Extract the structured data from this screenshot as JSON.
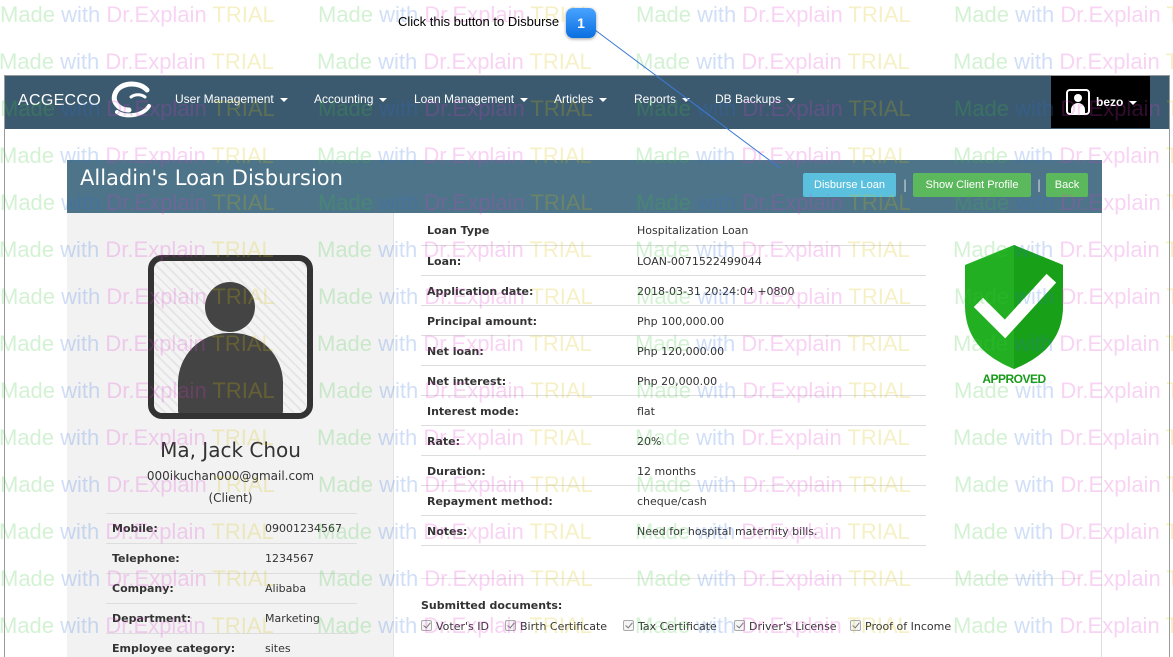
{
  "callout": {
    "label": "Click this button to Disburse",
    "number": "1"
  },
  "navbar": {
    "brand": "ACGECCO",
    "items": [
      {
        "label": "User Management"
      },
      {
        "label": "Accounting"
      },
      {
        "label": "Loan Management"
      },
      {
        "label": "Articles"
      },
      {
        "label": "Reports"
      },
      {
        "label": "DB Backups"
      }
    ],
    "user": "bezo"
  },
  "panel": {
    "title": "Alladin's Loan Disbursion",
    "buttons": {
      "disburse": "Disburse Loan",
      "show_profile": "Show Client Profile",
      "back": "Back"
    },
    "separator": "|"
  },
  "client": {
    "name": "Ma, Jack Chou",
    "email": "000ikuchan000@gmail.com",
    "role": "(Client)",
    "info": [
      {
        "label": "Mobile:",
        "value": "09001234567"
      },
      {
        "label": "Telephone:",
        "value": "1234567"
      },
      {
        "label": "Company:",
        "value": "Alibaba"
      },
      {
        "label": "Department:",
        "value": "Marketing"
      },
      {
        "label": "Employee category:",
        "value": "sites"
      }
    ]
  },
  "loan": {
    "details": [
      {
        "label": "Loan Type",
        "value": "Hospitalization Loan"
      },
      {
        "label": "Loan:",
        "value": "LOAN-0071522499044"
      },
      {
        "label": "Application date:",
        "value": "2018-03-31 20:24:04 +0800"
      },
      {
        "label": "Principal amount:",
        "value": "Php 100,000.00"
      },
      {
        "label": "Net loan:",
        "value": "Php 120,000.00"
      },
      {
        "label": "Net interest:",
        "value": "Php 20,000.00"
      },
      {
        "label": "Interest mode:",
        "value": "flat"
      },
      {
        "label": "Rate:",
        "value": "20%"
      },
      {
        "label": "Duration:",
        "value": "12 months"
      },
      {
        "label": "Repayment method:",
        "value": "cheque/cash"
      },
      {
        "label": "Notes:",
        "value": "Need for hospital maternity bills."
      }
    ],
    "status": "APPROVED"
  },
  "documents": {
    "title": "Submitted documents:",
    "items": [
      "Voter's ID",
      "Birth Certificate",
      "Tax Certificate",
      "Driver's License",
      "Proof of Income"
    ]
  },
  "watermark": {
    "p1": "Made",
    "p2": "with",
    "p3": "Dr.Explain",
    "p4": "TRIAL"
  },
  "colors": {
    "navbar": "#3b5a6f",
    "panel_header": "#4d7488",
    "btn_info": "#5bc0de",
    "btn_success": "#5cb85c",
    "approved_green": "#1a9a1a"
  }
}
